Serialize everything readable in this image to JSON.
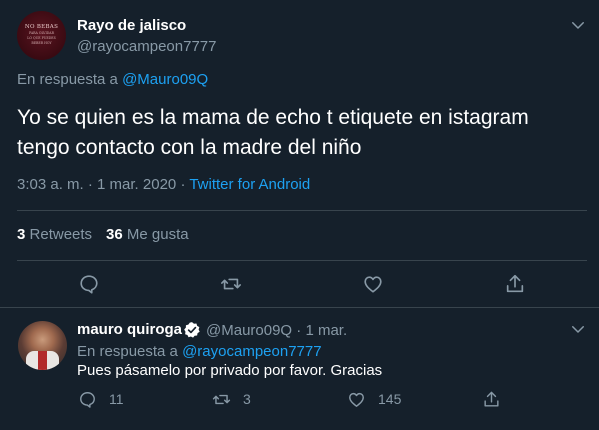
{
  "main_tweet": {
    "display_name": "Rayo de jalisco",
    "handle": "@rayocampeon7777",
    "avatar_text": [
      "NO BEBAS",
      "PARA OLVIDAR",
      "LO QUE PUEDES",
      "BEBER HOY"
    ],
    "reply_prefix": "En respuesta a",
    "reply_mention": "@Mauro09Q",
    "text_line_1": "Yo se quien es la mama de echo t etiquete en istagram",
    "text_line_2": "tengo contacto con la madre del niño",
    "time": "3:03 a. m.",
    "date": "1 mar. 2020",
    "separator": "·",
    "source": "Twitter for Android",
    "retweets_count": "3",
    "retweets_label": "Retweets",
    "likes_count": "36",
    "likes_label": "Me gusta"
  },
  "reply_tweet": {
    "display_name": "mauro quiroga",
    "handle": "@Mauro09Q",
    "separator": "·",
    "date": "1 mar.",
    "reply_prefix": "En respuesta a",
    "reply_mention": "@rayocampeon7777",
    "text": "Pues pásamelo por privado por favor. Gracias",
    "reply_count": "11",
    "retweet_count": "3",
    "like_count": "145"
  },
  "colors": {
    "background": "#15202b",
    "accent": "#1da1f2",
    "secondary_text": "#8899a6",
    "divider": "#38444d"
  },
  "icons": [
    "chevron-down-icon",
    "reply-icon",
    "retweet-icon",
    "like-icon",
    "share-icon",
    "verified-icon"
  ]
}
